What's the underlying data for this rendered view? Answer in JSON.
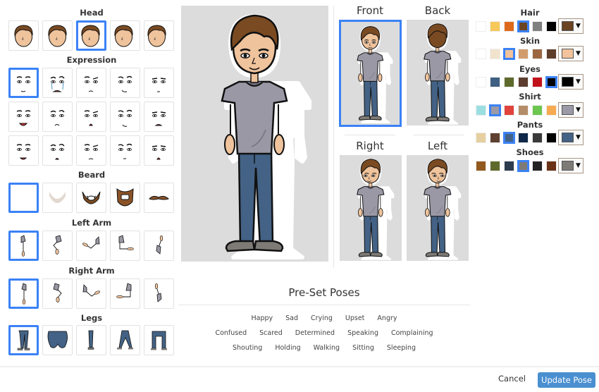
{
  "left_panel": {
    "sections": [
      {
        "title": "Head",
        "items": [
          "head-1",
          "head-2",
          "head-3",
          "head-4",
          "head-5"
        ],
        "selected": 2
      },
      {
        "title": "Expression",
        "items": [
          "neutral-smile",
          "crying",
          "skeptical",
          "smirk",
          "sleepy",
          "laughing",
          "frown-angry",
          "shocked-angry",
          "sneer",
          "scared",
          "grin",
          "upset-open",
          "angry-frown",
          "blank",
          "surprised"
        ],
        "selected": 0
      },
      {
        "title": "Beard",
        "items": [
          "none",
          "light-beard",
          "goatee-beard",
          "full-beard",
          "mustache"
        ],
        "selected": 0
      },
      {
        "title": "Left Arm",
        "items": [
          "down",
          "hand-on-hip",
          "raised-out",
          "bent-forward",
          "hand-up"
        ],
        "selected": 0
      },
      {
        "title": "Right Arm",
        "items": [
          "down",
          "hand-on-hip",
          "raised-out",
          "bent-forward",
          "hand-up"
        ],
        "selected": 0
      },
      {
        "title": "Legs",
        "items": [
          "standing",
          "sitting",
          "side",
          "spread",
          "wide"
        ],
        "selected": 0
      }
    ]
  },
  "views": {
    "items": [
      {
        "label": "Front",
        "selected": true
      },
      {
        "label": "Back",
        "selected": false
      },
      {
        "label": "Right",
        "selected": false
      },
      {
        "label": "Left",
        "selected": false
      }
    ]
  },
  "colors": [
    {
      "title": "Hair",
      "swatches": [
        "#ffffff",
        "#f7c85a",
        "#dd6a1c",
        "#6b4423",
        "#808080",
        "#000000"
      ],
      "selected": 3,
      "current": "#6b4423"
    },
    {
      "title": "Skin",
      "swatches": [
        "#ffffff",
        "#f2e3cd",
        "#f1c29b",
        "#d29d6c",
        "#9c6640",
        "#5e3d2b"
      ],
      "selected": 2,
      "current": "#f1c29b"
    },
    {
      "title": "Eyes",
      "swatches": [
        "#ffffff",
        "#3f5f83",
        "#5e6a2c",
        "#5c3d2e",
        "#c1121c",
        "#000000"
      ],
      "selected": 5,
      "current": "#000000"
    },
    {
      "title": "Shirt",
      "swatches": [
        "#9bdfe0",
        "#9b9aa6",
        "#e0433b",
        "#b48d68",
        "#6cc650",
        "#f7aa50"
      ],
      "selected": 1,
      "current": "#9b9aa6"
    },
    {
      "title": "Pants",
      "swatches": [
        "#e6cfa0",
        "#5e4030",
        "#436285",
        "#0f2849",
        "#3a3a3a",
        "#000000"
      ],
      "selected": 2,
      "current": "#436285"
    },
    {
      "title": "Shoes",
      "swatches": [
        "#92591f",
        "#5e6a2c",
        "#2d3b4e",
        "#7e7b77",
        "#222222",
        "#6a3216"
      ],
      "selected": 3,
      "current": "#7e7b77"
    }
  ],
  "presets": {
    "title": "Pre-Set Poses",
    "rows": [
      [
        "Happy",
        "Sad",
        "Crying",
        "Upset",
        "Angry"
      ],
      [
        "Confused",
        "Scared",
        "Determined",
        "Speaking",
        "Complaining"
      ],
      [
        "Shouting",
        "Holding",
        "Walking",
        "Sitting",
        "Sleeping"
      ]
    ]
  },
  "footer": {
    "cancel_label": "Cancel",
    "update_label": "Update Pose"
  }
}
